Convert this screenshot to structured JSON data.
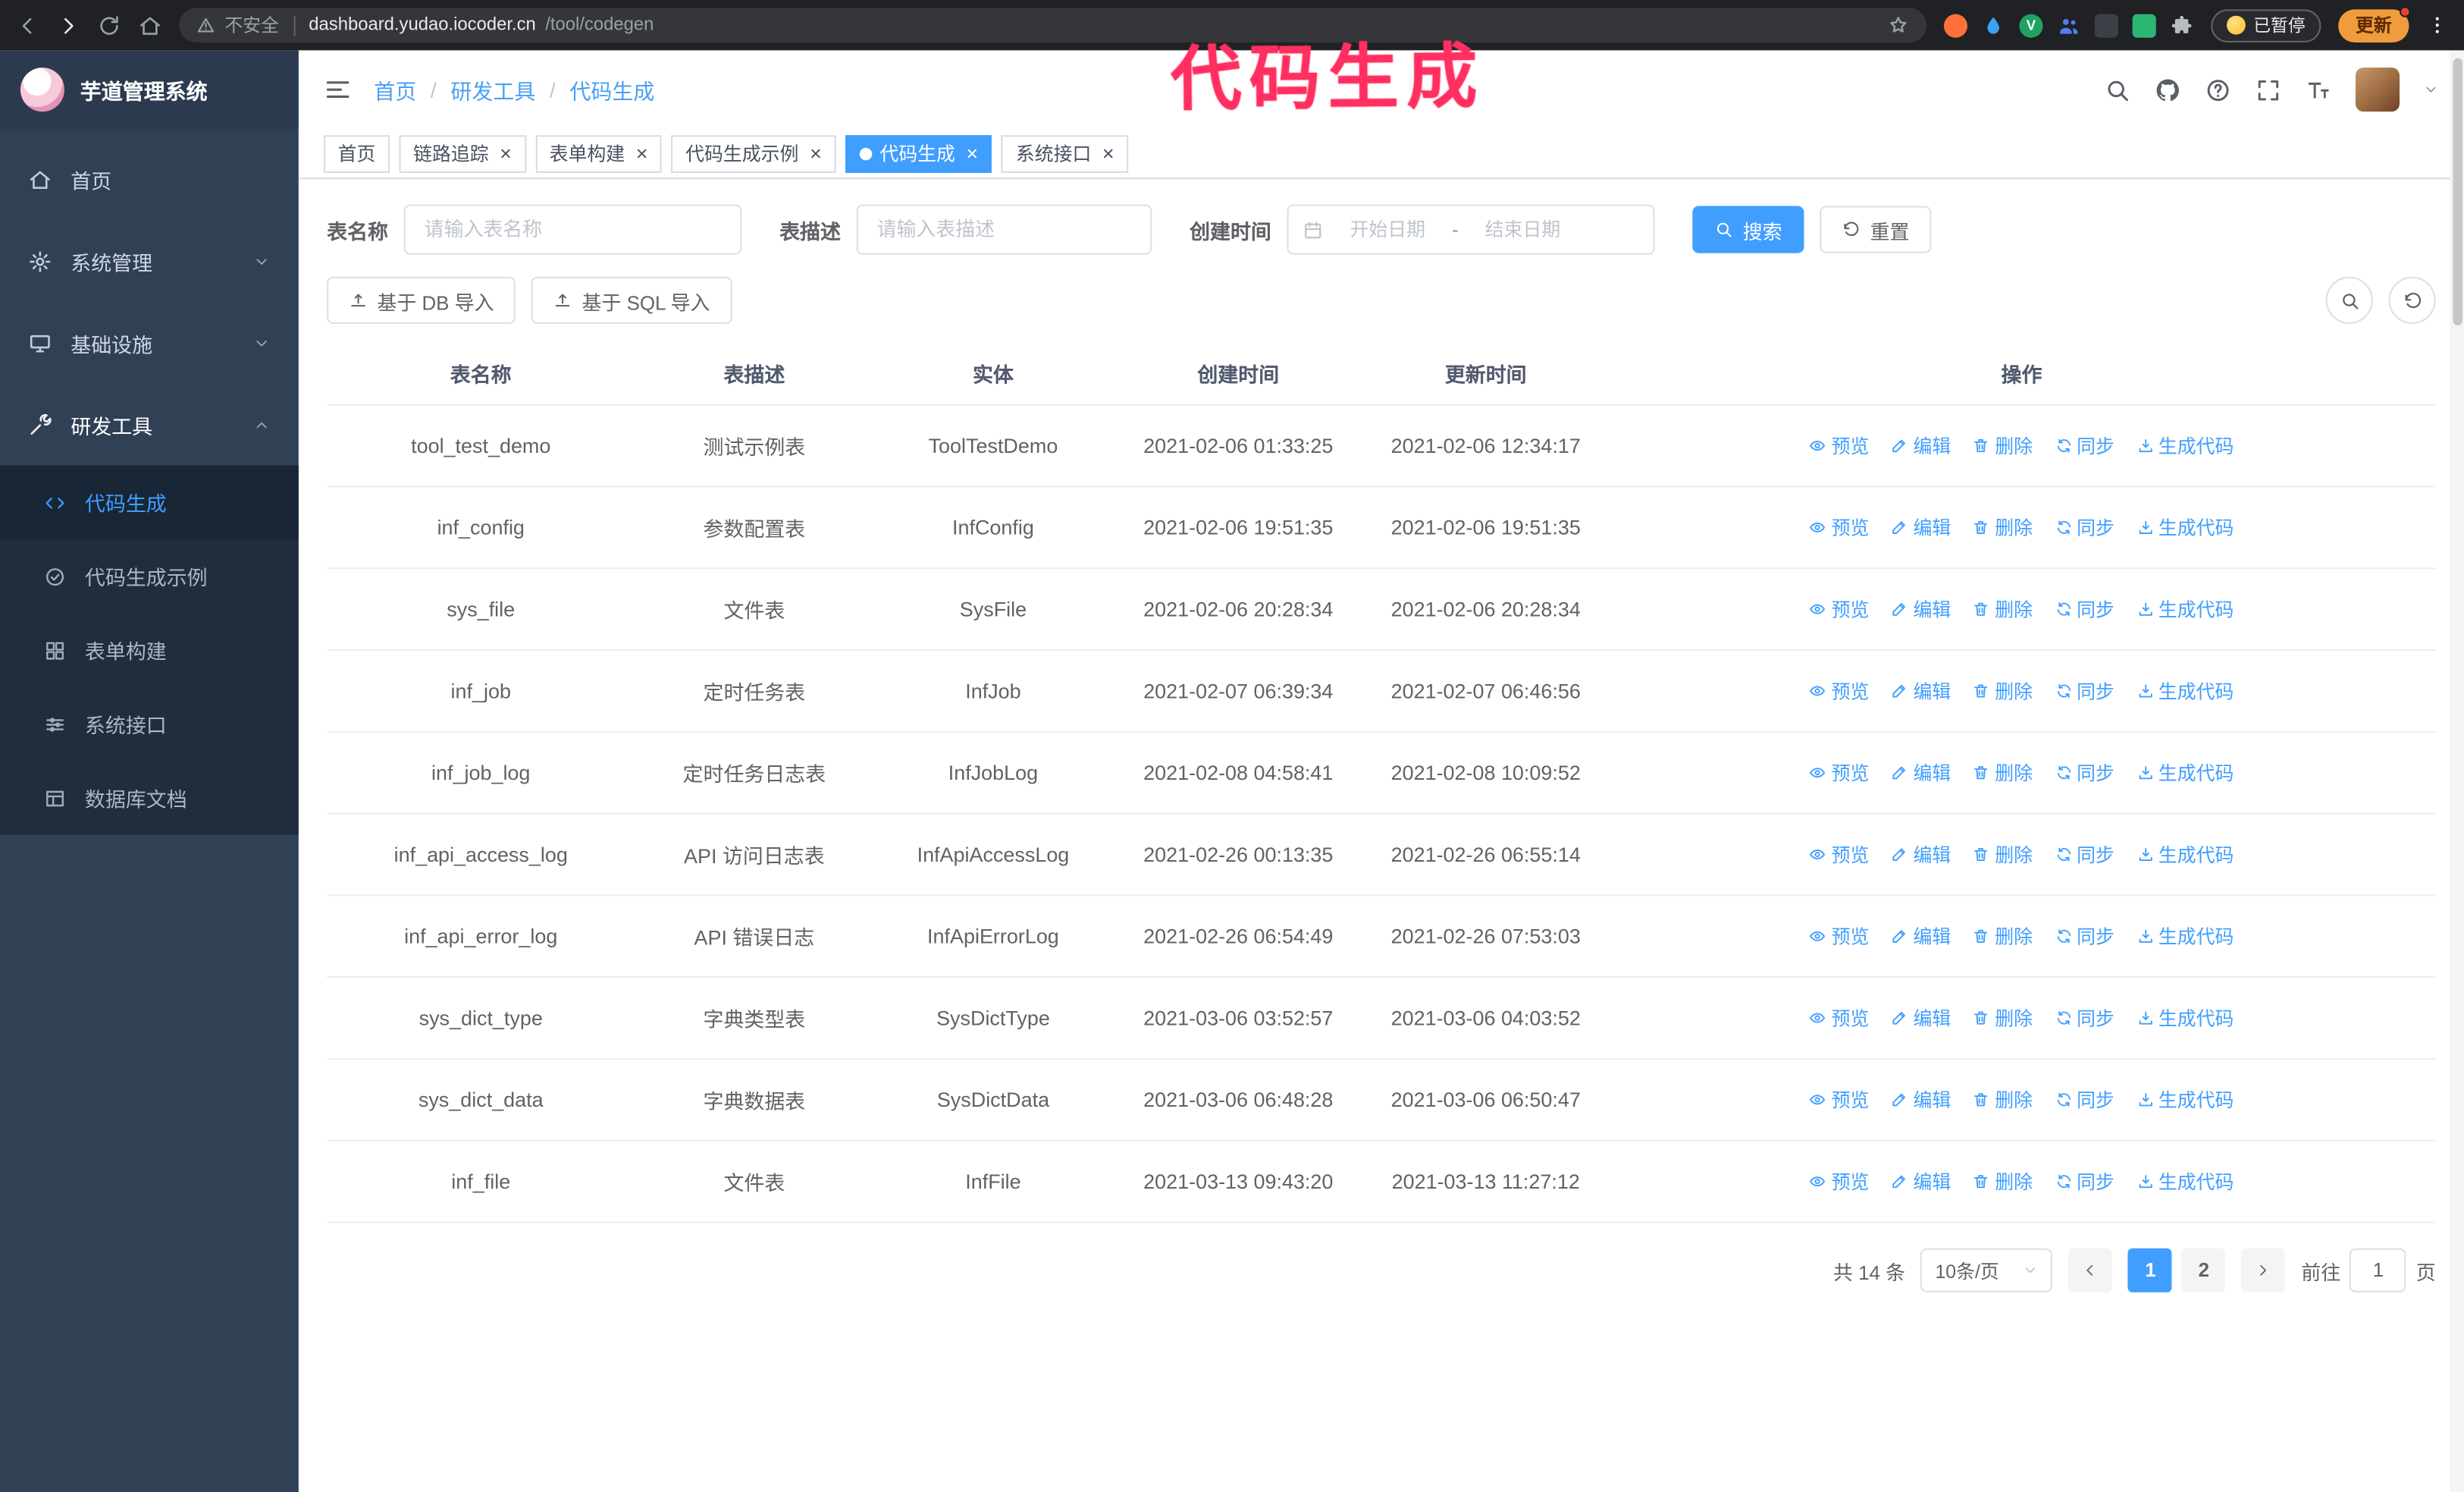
{
  "annotation": {
    "text": "代码生成"
  },
  "colors": {
    "accent": "#409eff",
    "annotation": "#ff3061",
    "sidebar_bg": "#304156",
    "submenu_bg": "#1f2d3d",
    "chrome_bg": "#202124"
  },
  "browser": {
    "security_label": "不安全",
    "url_host": "dashboard.yudao.iocoder.cn",
    "url_path": "/tool/codegen",
    "paused_badge_label": "已暂停",
    "update_button_label": "更新"
  },
  "sidebar": {
    "app_title": "芋道管理系统",
    "items": [
      {
        "id": "home",
        "label": "首页",
        "icon": "home-icon",
        "has_children": false,
        "expanded": false
      },
      {
        "id": "system",
        "label": "系统管理",
        "icon": "gear-icon",
        "has_children": true,
        "expanded": false
      },
      {
        "id": "infra",
        "label": "基础设施",
        "icon": "infra-icon",
        "has_children": true,
        "expanded": false
      },
      {
        "id": "dev-tools",
        "label": "研发工具",
        "icon": "tools-icon",
        "has_children": true,
        "expanded": true
      }
    ],
    "submenu": [
      {
        "id": "codegen",
        "label": "代码生成",
        "icon": "code-icon",
        "active": true
      },
      {
        "id": "codegen-example",
        "label": "代码生成示例",
        "icon": "example-icon",
        "active": false
      },
      {
        "id": "form-builder",
        "label": "表单构建",
        "icon": "form-icon",
        "active": false
      },
      {
        "id": "api",
        "label": "系统接口",
        "icon": "api-icon",
        "active": false
      },
      {
        "id": "db-doc",
        "label": "数据库文档",
        "icon": "dbdoc-icon",
        "active": false
      }
    ]
  },
  "header": {
    "breadcrumb": [
      "首页",
      "研发工具",
      "代码生成"
    ]
  },
  "tabs": [
    {
      "id": "home",
      "label": "首页",
      "active": false,
      "closable": false
    },
    {
      "id": "tracer",
      "label": "链路追踪",
      "active": false,
      "closable": true
    },
    {
      "id": "form-builder",
      "label": "表单构建",
      "active": false,
      "closable": true
    },
    {
      "id": "codegen-example",
      "label": "代码生成示例",
      "active": false,
      "closable": true
    },
    {
      "id": "codegen",
      "label": "代码生成",
      "active": true,
      "closable": true
    },
    {
      "id": "api",
      "label": "系统接口",
      "active": false,
      "closable": true
    }
  ],
  "filters": {
    "table_name_label": "表名称",
    "table_name_placeholder": "请输入表名称",
    "table_desc_label": "表描述",
    "table_desc_placeholder": "请输入表描述",
    "create_time_label": "创建时间",
    "date_start_placeholder": "开始日期",
    "date_separator": "-",
    "date_end_placeholder": "结束日期",
    "search_label": "搜索",
    "reset_label": "重置"
  },
  "toolbar": {
    "import_db_label": "基于 DB 导入",
    "import_sql_label": "基于 SQL 导入"
  },
  "table": {
    "columns": [
      "表名称",
      "表描述",
      "实体",
      "创建时间",
      "更新时间",
      "操作"
    ],
    "action_labels": [
      "预览",
      "编辑",
      "删除",
      "同步",
      "生成代码"
    ],
    "rows": [
      {
        "name": "tool_test_demo",
        "desc": "测试示例表",
        "entity": "ToolTestDemo",
        "created": "2021-02-06 01:33:25",
        "updated": "2021-02-06 12:34:17"
      },
      {
        "name": "inf_config",
        "desc": "参数配置表",
        "entity": "InfConfig",
        "created": "2021-02-06 19:51:35",
        "updated": "2021-02-06 19:51:35"
      },
      {
        "name": "sys_file",
        "desc": "文件表",
        "entity": "SysFile",
        "created": "2021-02-06 20:28:34",
        "updated": "2021-02-06 20:28:34"
      },
      {
        "name": "inf_job",
        "desc": "定时任务表",
        "entity": "InfJob",
        "created": "2021-02-07 06:39:34",
        "updated": "2021-02-07 06:46:56"
      },
      {
        "name": "inf_job_log",
        "desc": "定时任务日志表",
        "entity": "InfJobLog",
        "created": "2021-02-08 04:58:41",
        "updated": "2021-02-08 10:09:52"
      },
      {
        "name": "inf_api_access_log",
        "desc": "API 访问日志表",
        "entity": "InfApiAccessLog",
        "created": "2021-02-26 00:13:35",
        "updated": "2021-02-26 06:55:14"
      },
      {
        "name": "inf_api_error_log",
        "desc": "API 错误日志",
        "entity": "InfApiErrorLog",
        "created": "2021-02-26 06:54:49",
        "updated": "2021-02-26 07:53:03"
      },
      {
        "name": "sys_dict_type",
        "desc": "字典类型表",
        "entity": "SysDictType",
        "created": "2021-03-06 03:52:57",
        "updated": "2021-03-06 04:03:52"
      },
      {
        "name": "sys_dict_data",
        "desc": "字典数据表",
        "entity": "SysDictData",
        "created": "2021-03-06 06:48:28",
        "updated": "2021-03-06 06:50:47"
      },
      {
        "name": "inf_file",
        "desc": "文件表",
        "entity": "InfFile",
        "created": "2021-03-13 09:43:20",
        "updated": "2021-03-13 11:27:12"
      }
    ]
  },
  "pagination": {
    "total_text": "共 14 条",
    "page_size_text": "10条/页",
    "pages": [
      "1",
      "2"
    ],
    "active_page": "1",
    "goto_prefix": "前往",
    "goto_value": "1",
    "goto_suffix": "页"
  }
}
